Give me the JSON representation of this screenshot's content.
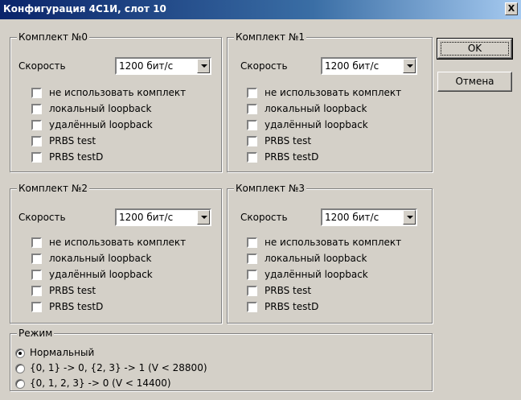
{
  "window": {
    "title": "Конфигурация 4С1И, слот 10",
    "close_label": "X"
  },
  "buttons": {
    "ok": "OK",
    "cancel": "Отмена"
  },
  "kits": [
    {
      "title": "Комплект №0",
      "speed_label": "Скорость",
      "speed_value": "1200 бит/с",
      "options": [
        "не использовать комплект",
        "локальный loopback",
        "удалённый loopback",
        "PRBS test",
        "PRBS testD"
      ]
    },
    {
      "title": "Комплект №1",
      "speed_label": "Скорость",
      "speed_value": "1200 бит/с",
      "options": [
        "не использовать комплект",
        "локальный loopback",
        "удалённый loopback",
        "PRBS test",
        "PRBS testD"
      ]
    },
    {
      "title": "Комплект №2",
      "speed_label": "Скорость",
      "speed_value": "1200 бит/с",
      "options": [
        "не использовать комплект",
        "локальный loopback",
        "удалённый loopback",
        "PRBS test",
        "PRBS testD"
      ]
    },
    {
      "title": "Комплект №3",
      "speed_label": "Скорость",
      "speed_value": "1200 бит/с",
      "options": [
        "не использовать комплект",
        "локальный loopback",
        "удалённый loopback",
        "PRBS test",
        "PRBS testD"
      ]
    }
  ],
  "mode": {
    "title": "Режим",
    "options": [
      "Нормальный",
      "{0, 1} -> 0, {2, 3} -> 1 (V < 28800)",
      "{0, 1, 2, 3} -> 0  (V < 14400)"
    ],
    "selected_index": 0
  }
}
